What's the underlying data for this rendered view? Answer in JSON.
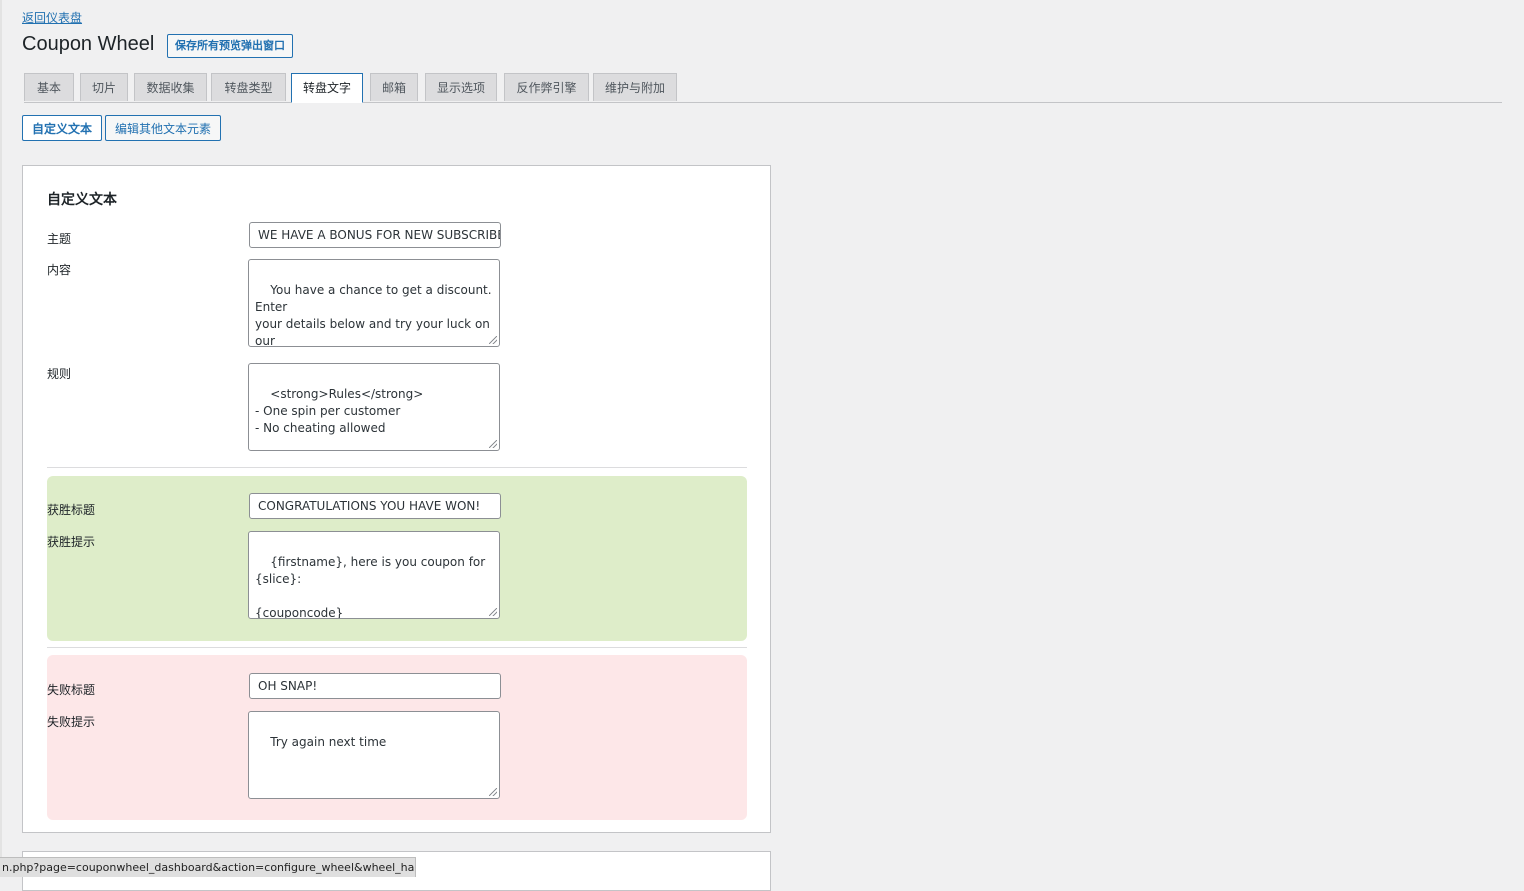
{
  "header": {
    "back_link": "返回仪表盘",
    "title": "Coupon Wheel",
    "save_button": "保存所有预览弹出窗口"
  },
  "tabs": [
    {
      "label": "基本",
      "active": false
    },
    {
      "label": "切片",
      "active": false
    },
    {
      "label": "数据收集",
      "active": false
    },
    {
      "label": "转盘类型",
      "active": false
    },
    {
      "label": "转盘文字",
      "active": true
    },
    {
      "label": "邮箱",
      "active": false
    },
    {
      "label": "显示选项",
      "active": false
    },
    {
      "label": "反作弊引擎",
      "active": false
    },
    {
      "label": "维护与附加",
      "active": false
    }
  ],
  "subtabs": {
    "custom_text": "自定义文本",
    "edit_other": "编辑其他文本元素"
  },
  "section": {
    "title": "自定义文本",
    "fields": {
      "subject_label": "主题",
      "subject_value": "WE HAVE A BONUS FOR NEW SUBSCRIBERS",
      "content_label": "内容",
      "content_value": "You have a chance to get a discount. Enter\nyour details below and try your luck on our\nCoupon Wheel:",
      "rules_label": "规则",
      "rules_value": "<strong>Rules</strong>\n- One spin per customer\n- No cheating allowed",
      "win_title_label": "获胜标题",
      "win_title_value": "CONGRATULATIONS YOU HAVE WON!",
      "win_hint_label": "获胜提示",
      "win_hint_value": "{firstname}, here is you coupon for {slice}:\n\n{couponcode}",
      "lose_title_label": "失败标题",
      "lose_title_value": "OH SNAP!",
      "lose_hint_label": "失败提示",
      "lose_hint_value": "Try again next time"
    }
  },
  "status_bar": {
    "url": "n.php?page=couponwheel_dashboard&action=configure_wheel&wheel_ha..."
  },
  "colors": {
    "accent": "#2271b1",
    "win_background": "#deedc9",
    "lose_background": "#fde7e8"
  }
}
